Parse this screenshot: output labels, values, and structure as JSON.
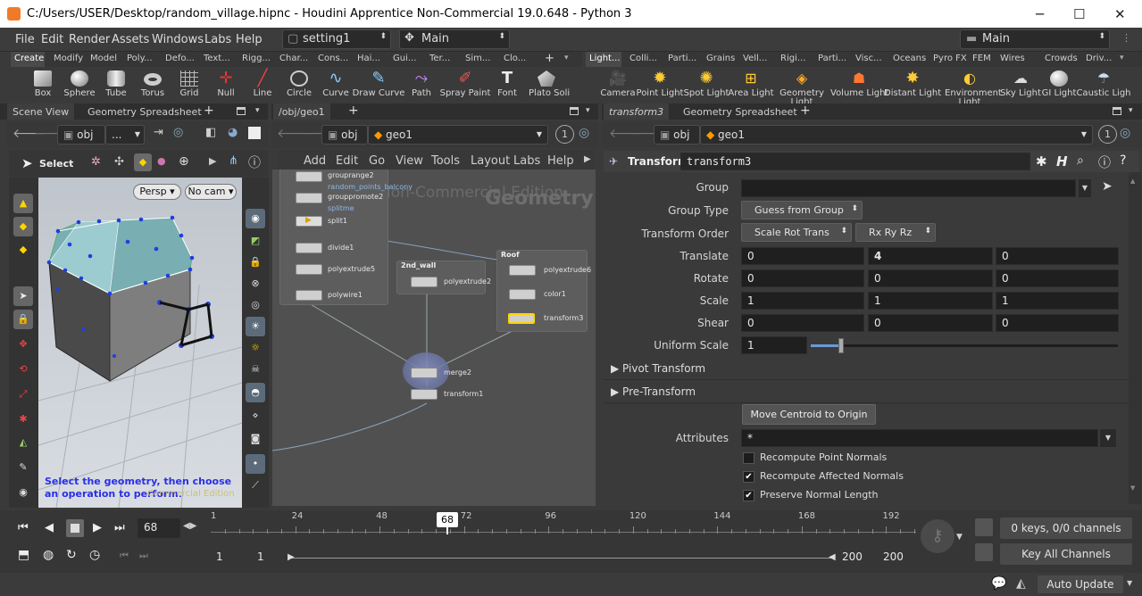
{
  "window": {
    "title": "C:/Users/USER/Desktop/random_village.hipnc - Houdini Apprentice Non-Commercial 19.0.648 - Python 3",
    "minimize": "─",
    "maximize": "☐",
    "close": "✕"
  },
  "menu": {
    "items": [
      "File",
      "Edit",
      "Render",
      "Assets",
      "Windows",
      "Labs",
      "Help"
    ],
    "desktop": "setting1",
    "context": "Main",
    "desktop_right": "Main"
  },
  "shelf_left": {
    "tabs": [
      "Create",
      "Modify",
      "Model",
      "Poly...",
      "Defo...",
      "Text...",
      "Rigg...",
      "Char...",
      "Cons...",
      "Hai...",
      "Gui...",
      "Ter...",
      "Sim...",
      "Clo..."
    ],
    "tools": [
      "Box",
      "Sphere",
      "Tube",
      "Torus",
      "Grid",
      "Null",
      "Line",
      "Circle",
      "Curve",
      "Draw Curve",
      "Path",
      "Spray Paint",
      "Font",
      "Plato Soli"
    ]
  },
  "shelf_right": {
    "tabs": [
      "Light...",
      "Colli...",
      "Parti...",
      "Grains",
      "Vell...",
      "Rigi...",
      "Parti...",
      "Visc...",
      "Oceans",
      "Pyro FX",
      "FEM",
      "Wires",
      "Crowds",
      "Driv..."
    ],
    "tools": [
      "Camera",
      "Point Light",
      "Spot Light",
      "Area Light",
      "Geometry Light",
      "Volume Light",
      "Distant Light",
      "Environment Light",
      "Sky Light",
      "GI Light",
      "Caustic Ligh"
    ]
  },
  "left_pane": {
    "tabs": [
      "Scene View",
      "Geometry Spreadsheet"
    ],
    "path": "obj",
    "path2": "...",
    "select_label": "Select",
    "persp": "Persp ▾",
    "cam": "No cam ▾",
    "hint": "Select the geometry, then choose an operation to perform.",
    "watermark": "Commercial Edition"
  },
  "network_pane": {
    "tab": "/obj/geo1",
    "path_obj": "obj",
    "path_geo": "geo1",
    "menu": [
      "Add",
      "Edit",
      "Go",
      "View",
      "Tools",
      "Layout",
      "Labs",
      "Help"
    ],
    "watermark": "Non-Commercial Edition",
    "context_label": "Geometry",
    "nodes": [
      "grouprange2",
      "random_points_balcony",
      "grouppromote2",
      "splitme",
      "split1",
      "divide1",
      "polyextrude5",
      "polywire1",
      "polyextrude2",
      "polyextrude6",
      "color1",
      "transform3",
      "merge2",
      "transform1"
    ],
    "boxes": [
      "2nd_wall",
      "Roof"
    ]
  },
  "param_pane": {
    "tabs": [
      "transform3",
      "Geometry Spreadsheet"
    ],
    "path_obj": "obj",
    "path_geo": "geo1",
    "node_type": "Transform",
    "node_name": "transform3",
    "labels": {
      "group": "Group",
      "group_type": "Group Type",
      "order": "Transform Order",
      "translate": "Translate",
      "rotate": "Rotate",
      "scale": "Scale",
      "shear": "Shear",
      "uniform": "Uniform Scale",
      "attributes": "Attributes"
    },
    "group_type": "Guess from Group",
    "xform_order": "Scale Rot Trans",
    "rot_order": "Rx Ry Rz",
    "translate": [
      "0",
      "4",
      "0"
    ],
    "rotate": [
      "0",
      "0",
      "0"
    ],
    "scale": [
      "1",
      "1",
      "1"
    ],
    "shear": [
      "0",
      "0",
      "0"
    ],
    "uniform_scale": "1",
    "uniform_scale_level": 0.1,
    "folders": [
      "Pivot Transform",
      "Pre-Transform"
    ],
    "centroid_button": "Move Centroid to Origin",
    "attributes": "*",
    "checks": [
      {
        "label": "Recompute Point Normals",
        "checked": false
      },
      {
        "label": "Recompute Affected Normals",
        "checked": true
      },
      {
        "label": "Preserve Normal Length",
        "checked": true
      }
    ]
  },
  "timeline": {
    "frame": "68",
    "marker": "68",
    "ticks": [
      "1",
      "24",
      "48",
      "72",
      "96",
      "120",
      "144",
      "168",
      "192"
    ],
    "start": "1",
    "start2": "1",
    "end": "200",
    "end2": "200",
    "keys": "0 keys, 0/0 channels",
    "key_all": "Key All Channels"
  },
  "status": {
    "auto_update": "Auto Update"
  },
  "colors": {
    "accent": "#f27a26",
    "bg": "#3a3a3a",
    "selection": "#ffd400"
  }
}
